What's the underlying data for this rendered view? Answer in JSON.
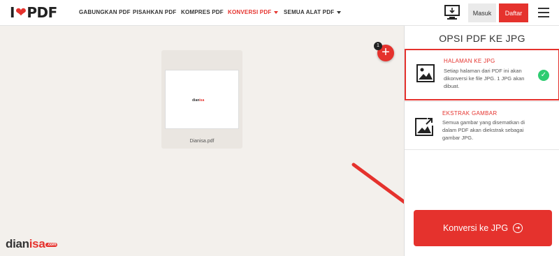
{
  "logo": {
    "prefix": "I",
    "suffix": "PDF"
  },
  "nav": {
    "items": [
      {
        "label": "GABUNGKAN PDF"
      },
      {
        "label": "PISAHKAN PDF"
      },
      {
        "label": "KOMPRES PDF"
      },
      {
        "label": "KONVERSI PDF",
        "active": true,
        "dropdown": true
      },
      {
        "label": "SEMUA ALAT PDF",
        "dropdown": true
      }
    ],
    "login": "Masuk",
    "signup": "Daftar"
  },
  "workspace": {
    "file_name": "Dianisa.pdf",
    "thumb_text": {
      "base": "dian",
      "accent": "isa"
    },
    "file_count_badge": "1",
    "add_icon": "plus-icon"
  },
  "panel": {
    "title": "OPSI PDF KE JPG",
    "options": [
      {
        "title": "HALAMAN KE JPG",
        "description": "Setiap halaman dari PDF ini akan dikonversi ke file JPG. 1 JPG akan dibuat.",
        "selected": true,
        "icon": "image-icon"
      },
      {
        "title": "EKSTRAK GAMBAR",
        "description": "Semua gambar yang disematkan di dalam PDF akan diekstrak sebagai gambar JPG.",
        "selected": false,
        "icon": "image-extract-icon"
      }
    ],
    "convert_button": "Konversi ke JPG"
  },
  "watermark": {
    "base": "dian",
    "accent": "isa",
    "domain": ".com"
  },
  "colors": {
    "accent": "#e5322d",
    "success": "#2ecc71"
  }
}
